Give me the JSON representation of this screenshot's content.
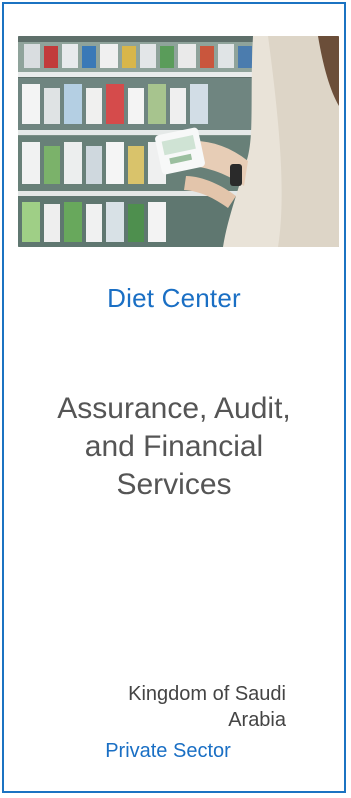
{
  "card": {
    "image_alt": "Customer holding a yogurt product in a supermarket dairy aisle",
    "title": "Diet Center",
    "service_line1": "Assurance, Audit,",
    "service_line2": "and Financial",
    "service_line3": "Services",
    "location_line1": "Kingdom of Saudi",
    "location_line2": "Arabia",
    "sector": "Private Sector"
  },
  "colors": {
    "accent": "#1a6fc4",
    "border": "#1b73c2",
    "body_text": "#555555"
  }
}
